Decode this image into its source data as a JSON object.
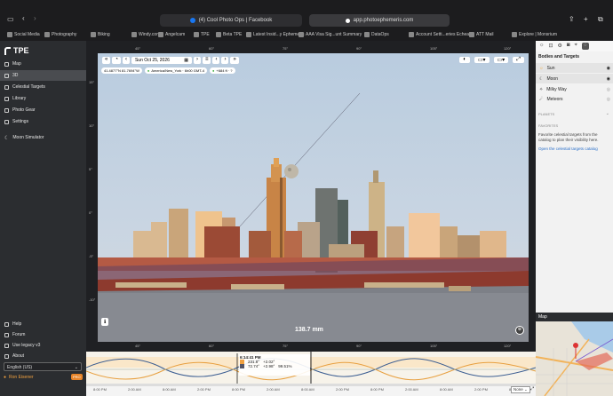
{
  "browser": {
    "active_tab": "(4) Cool Photo Ops | Facebook",
    "url": "app.photoephemeris.com",
    "bookmarks": [
      "Social Media",
      "Photography",
      "Biking",
      "Windy.com",
      "Angelcam",
      "TPE",
      "Beta TPE",
      "Latest Insid...y Ephemeris",
      "AAA Visa Sig...unt Summary",
      "DataOps",
      "Account Setti...eries Echeals",
      "ATT Mail",
      "Explore | Monsrium"
    ]
  },
  "sidebar": {
    "app_name": "TPE",
    "items": [
      {
        "label": "Map"
      },
      {
        "label": "3D"
      },
      {
        "label": "Celestial Targets"
      },
      {
        "label": "Library"
      },
      {
        "label": "Photo Gear"
      },
      {
        "label": "Settings"
      }
    ],
    "moon_simulator": "Moon Simulator",
    "footer": [
      {
        "label": "Help"
      },
      {
        "label": "Forum"
      },
      {
        "label": "Use legacy v3"
      },
      {
        "label": "About"
      }
    ],
    "language": "English (US)",
    "user": "Ron Eisener",
    "badge": "PRO"
  },
  "toolbar": {
    "date": "Sun Oct 25, 2026",
    "coords": "41.4877°N 81.7694°W",
    "timezone": "America/New_York · 6h00 GMT-4",
    "elevation": "+684 ft · ?"
  },
  "viewport": {
    "focal_length": "138.7 mm",
    "top_ticks": [
      "45°",
      "60°",
      "75°",
      "90°",
      "105°",
      "120°",
      "135°"
    ],
    "bottom_ticks": [
      "45°",
      "60°",
      "75°",
      "90°",
      "105°",
      "120°"
    ],
    "left_ticks": [
      "15°",
      "10°",
      "5°",
      "0°",
      "-5°",
      "-10°"
    ]
  },
  "right_panel": {
    "heading": "Bodies and Targets",
    "bodies": [
      {
        "label": "Sun"
      },
      {
        "label": "Moon"
      },
      {
        "label": "Milky Way"
      },
      {
        "label": "Meteors"
      }
    ],
    "planets_label": "PLANETS",
    "favorites_label": "FAVORITES",
    "favorites_text": "Favorite celestial targets from the catalog to plan their visibility here.",
    "catalog_link": "Open the celestial targets catalog",
    "map_label": "Map"
  },
  "timeline": {
    "time": "6:14:41 PM",
    "sun_az": "231.8°",
    "sun_alt": "+2.02°",
    "moon_az": "72.74°",
    "moon_alt": "+2.98°",
    "moon_pct": "99.51%",
    "ticks": [
      "8:00 PM",
      "2:00 AM",
      "8:00 AM",
      "2:00 PM",
      "8:00 PM",
      "2:00 AM",
      "8:00 AM",
      "2:00 PM",
      "8:00 PM",
      "2:00 AM",
      "8:00 AM",
      "2:00 PM",
      "8:00 PM"
    ],
    "selector": "None"
  }
}
